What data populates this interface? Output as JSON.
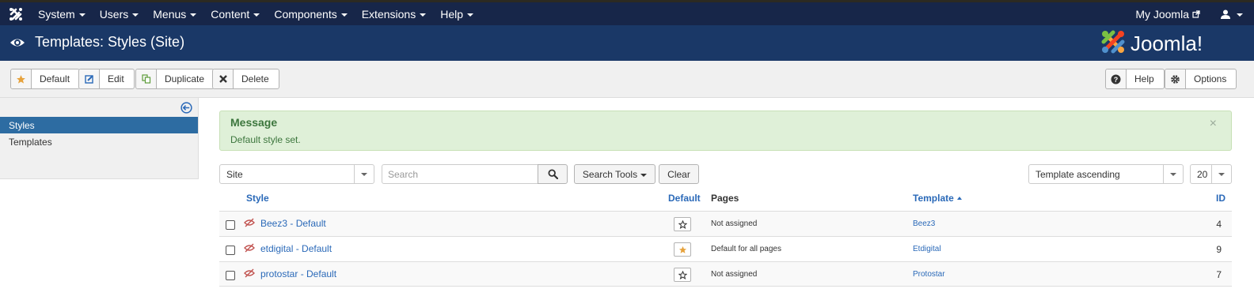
{
  "nav": {
    "items": [
      "System",
      "Users",
      "Menus",
      "Content",
      "Components",
      "Extensions",
      "Help"
    ],
    "my_joomla": "My Joomla"
  },
  "header": {
    "title": "Templates: Styles (Site)",
    "brand": "Joomla!"
  },
  "toolbar": {
    "default": "Default",
    "edit": "Edit",
    "duplicate": "Duplicate",
    "delete": "Delete",
    "help": "Help",
    "options": "Options"
  },
  "sidebar": {
    "items": [
      {
        "label": "Styles",
        "active": true
      },
      {
        "label": "Templates",
        "active": false
      }
    ]
  },
  "message": {
    "heading": "Message",
    "text": "Default style set.",
    "close": "×"
  },
  "filters": {
    "client": "Site",
    "search_placeholder": "Search",
    "search_tools": "Search Tools",
    "clear": "Clear",
    "ordering": "Template ascending",
    "limit": "20"
  },
  "table": {
    "headers": {
      "style": "Style",
      "default": "Default",
      "pages": "Pages",
      "template": "Template",
      "id": "ID"
    },
    "rows": [
      {
        "style": "Beez3 - Default",
        "is_default": false,
        "pages": "Not assigned",
        "template": "Beez3",
        "id": "4"
      },
      {
        "style": "etdigital - Default",
        "is_default": true,
        "pages": "Default for all pages",
        "template": "Etdigital",
        "id": "9"
      },
      {
        "style": "protostar - Default",
        "is_default": false,
        "pages": "Not assigned",
        "template": "Protostar",
        "id": "7"
      }
    ]
  },
  "colors": {
    "nav_bg": "#172649",
    "header_bg": "#1a3867",
    "link": "#2a69b8",
    "star_active": "#e6a23c",
    "alert_bg": "#dff0d8"
  }
}
